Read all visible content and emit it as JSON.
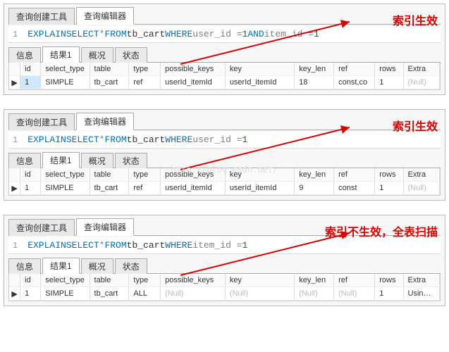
{
  "tabs": {
    "builder": "查询创建工具",
    "editor": "查询编辑器"
  },
  "subtabs": {
    "info": "信息",
    "result": "结果1",
    "profile": "概况",
    "status": "状态"
  },
  "columns": [
    "id",
    "select_type",
    "table",
    "type",
    "possible_keys",
    "key",
    "key_len",
    "ref",
    "rows",
    "Extra"
  ],
  "panels": [
    {
      "sql": {
        "line": "1",
        "tokens": [
          "EXPLAIN",
          " ",
          "SELECT",
          " * ",
          "FROM",
          " tb_cart ",
          "WHERE",
          " user_id = ",
          "1",
          " ",
          "AND",
          " item_id = ",
          "1"
        ]
      },
      "callout": "索引生效",
      "row": {
        "id": "1",
        "select_type": "SIMPLE",
        "table": "tb_cart",
        "type": "ref",
        "possible_keys": "userId_itemId",
        "key": "userId_itemId",
        "key_len": "18",
        "ref": "const,co",
        "rows": "1",
        "extra": "(Null)"
      },
      "selected": true
    },
    {
      "sql": {
        "line": "1",
        "tokens": [
          "EXPLAIN",
          " ",
          "SELECT",
          " * ",
          "FROM",
          " tb_cart ",
          "WHERE",
          " user_id = ",
          "1"
        ]
      },
      "callout": "索引生效",
      "watermark": "http://blog.csdn.net/",
      "row": {
        "id": "1",
        "select_type": "SIMPLE",
        "table": "tb_cart",
        "type": "ref",
        "possible_keys": "userId_itemId",
        "key": "userId_itemId",
        "key_len": "9",
        "ref": "const",
        "rows": "1",
        "extra": "(Null)"
      },
      "selected": false
    },
    {
      "sql": {
        "line": "1",
        "tokens": [
          "EXPLAIN",
          " ",
          "SELECT",
          " * ",
          "FROM",
          " tb_cart ",
          "WHERE",
          " item_id = ",
          "1"
        ]
      },
      "callout": "索引不生效，全表扫描",
      "row": {
        "id": "1",
        "select_type": "SIMPLE",
        "table": "tb_cart",
        "type": "ALL",
        "possible_keys": "(Null)",
        "key": "(Null)",
        "key_len": "(Null)",
        "ref": "(Null)",
        "rows": "1",
        "extra": "Using whe"
      },
      "selected": false
    }
  ]
}
